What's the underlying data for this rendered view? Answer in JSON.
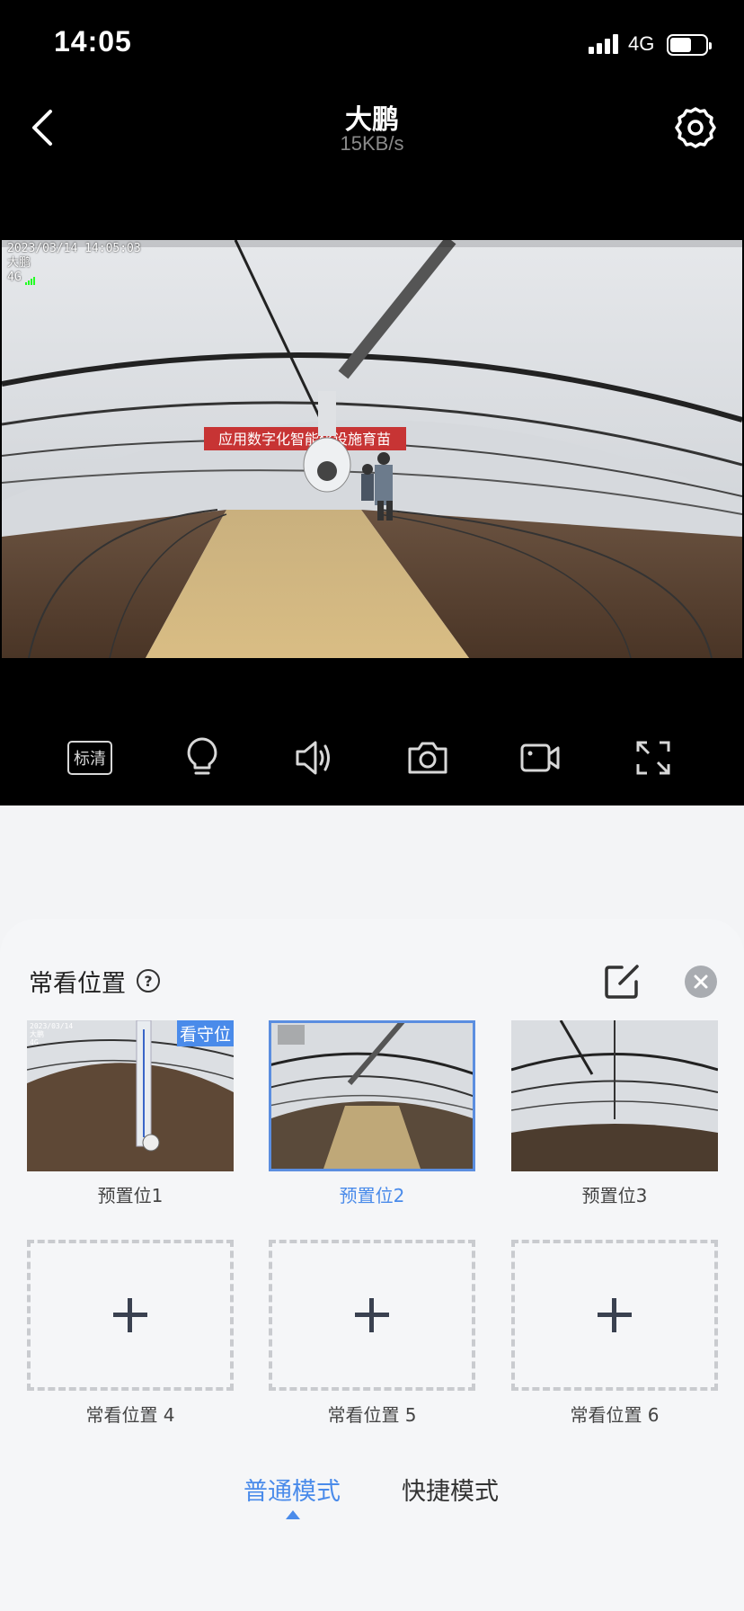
{
  "status_bar": {
    "time": "14:05",
    "network": "4G",
    "battery_level": 0.6
  },
  "header": {
    "title": "大鹏",
    "subtitle": "15KB/s"
  },
  "video": {
    "osd_datetime": "2023/03/14 14:05:03",
    "osd_name": "大鹏",
    "osd_network": "4G",
    "banner_text": "应用数字化智能化设施育苗"
  },
  "controls": {
    "quality_label": "标清",
    "icons": [
      "light-bulb-icon",
      "speaker-icon",
      "camera-icon",
      "video-record-icon",
      "fullscreen-icon"
    ]
  },
  "presets_panel": {
    "title": "常看位置",
    "presets": [
      {
        "label": "预置位1",
        "badge": "看守位",
        "selected": false
      },
      {
        "label": "预置位2",
        "selected": true
      },
      {
        "label": "预置位3",
        "selected": false
      }
    ],
    "empty_slots": [
      {
        "label": "常看位置 4"
      },
      {
        "label": "常看位置 5"
      },
      {
        "label": "常看位置 6"
      }
    ]
  },
  "modes": {
    "normal": "普通模式",
    "quick": "快捷模式",
    "active": "normal"
  },
  "colors": {
    "accent": "#4a8bea",
    "background": "#000000",
    "panel": "#f5f6f8"
  }
}
